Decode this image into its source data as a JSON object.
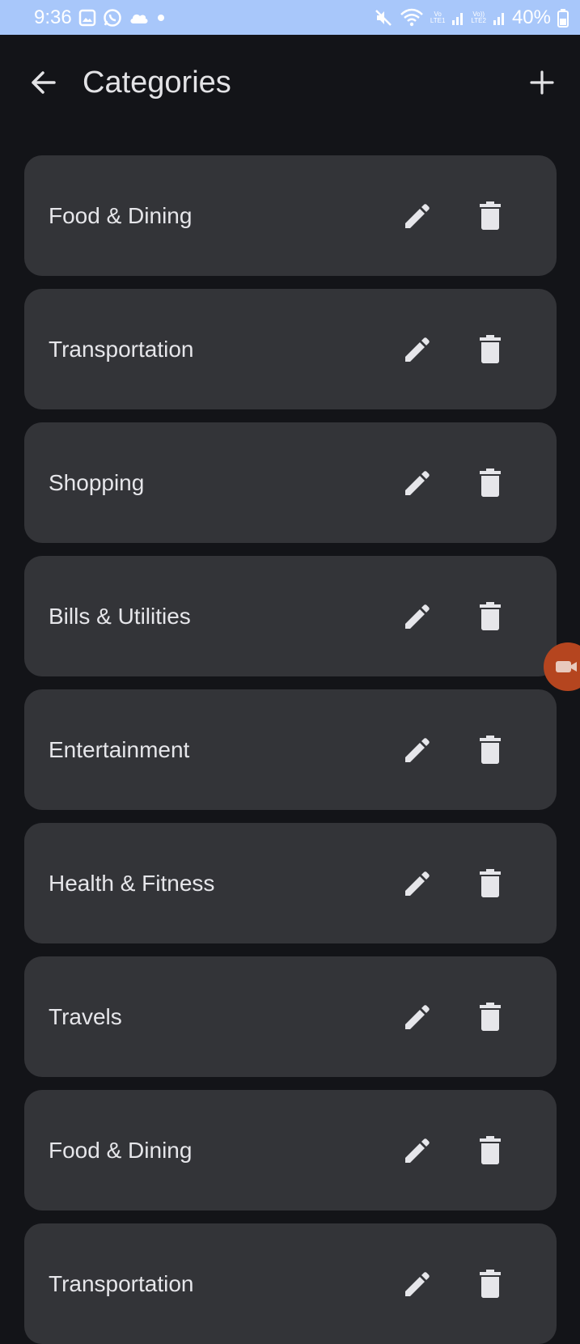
{
  "status_bar": {
    "time": "9:36",
    "battery": "40%",
    "left_icons": [
      "gallery-icon",
      "whatsapp-icon",
      "cloud-icon",
      "dot-icon"
    ],
    "right_icons": [
      "mute-icon",
      "wifi-icon",
      "signal-icon",
      "signal-icon",
      "battery-icon"
    ],
    "net1_top": "Vo",
    "net1_bottom": "LTE1",
    "net2_top": "Vo))",
    "net2_bottom": "LTE2",
    "bg_color": "#a8c7fa"
  },
  "app_bar": {
    "title": "Categories",
    "back_icon": "arrow-left-icon",
    "add_icon": "plus-icon"
  },
  "categories": [
    {
      "name": "Food & Dining"
    },
    {
      "name": "Transportation"
    },
    {
      "name": "Shopping"
    },
    {
      "name": "Bills & Utilities"
    },
    {
      "name": "Entertainment"
    },
    {
      "name": "Health & Fitness"
    },
    {
      "name": "Travels"
    },
    {
      "name": "Food & Dining"
    },
    {
      "name": "Transportation"
    }
  ],
  "item_icons": {
    "edit": "pencil-icon",
    "delete": "trash-icon"
  },
  "colors": {
    "background": "#131418",
    "card": "#333438",
    "text": "#e6e6ea",
    "bubble": "#b5451f"
  }
}
